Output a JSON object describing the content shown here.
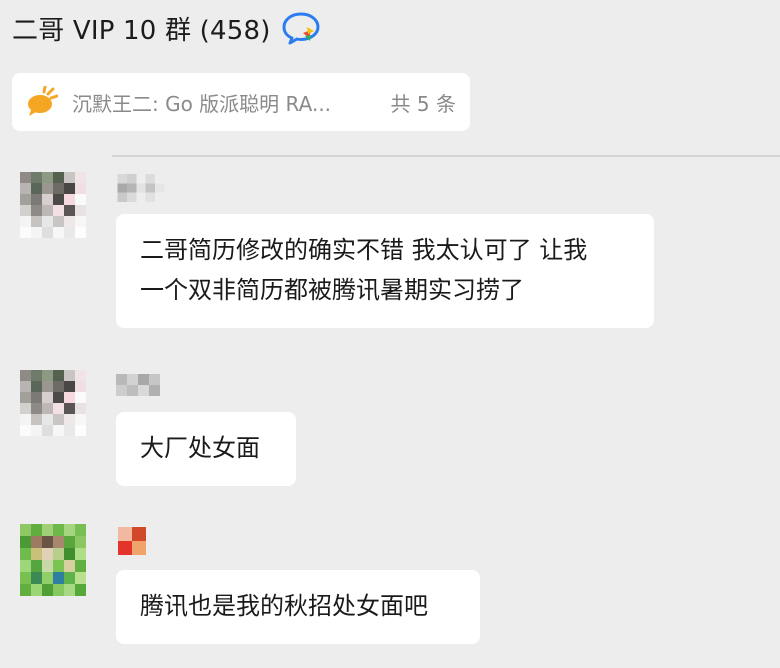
{
  "header": {
    "title": "二哥 VIP 10 群 (458)",
    "icon": "group-chat-icon"
  },
  "pinned": {
    "icon": "megaphone-icon",
    "text": "沉默王二: Go 版派聪明 RA...",
    "count": "共 5 条"
  },
  "messages": [
    {
      "avatar": "pixelated-avatar",
      "sender_display": "pixelated-name",
      "text_lines": [
        "二哥简历修改的确实不错 我太认可了 让我",
        "一个双非简历都被腾讯暑期实习捞了"
      ]
    },
    {
      "avatar": "pixelated-avatar",
      "sender_display": "pixelated-name",
      "text_lines": [
        "大厂处女面"
      ]
    },
    {
      "avatar": "pixelated-avatar",
      "sender_display": "pixelated-name",
      "text_lines": [
        "腾讯也是我的秋招处女面吧"
      ]
    }
  ],
  "colors": {
    "background": "#ededed",
    "bubble": "#ffffff",
    "muted_text": "#8a8a8a",
    "accent_blue": "#2b7cf0",
    "accent_orange": "#f5a623"
  }
}
